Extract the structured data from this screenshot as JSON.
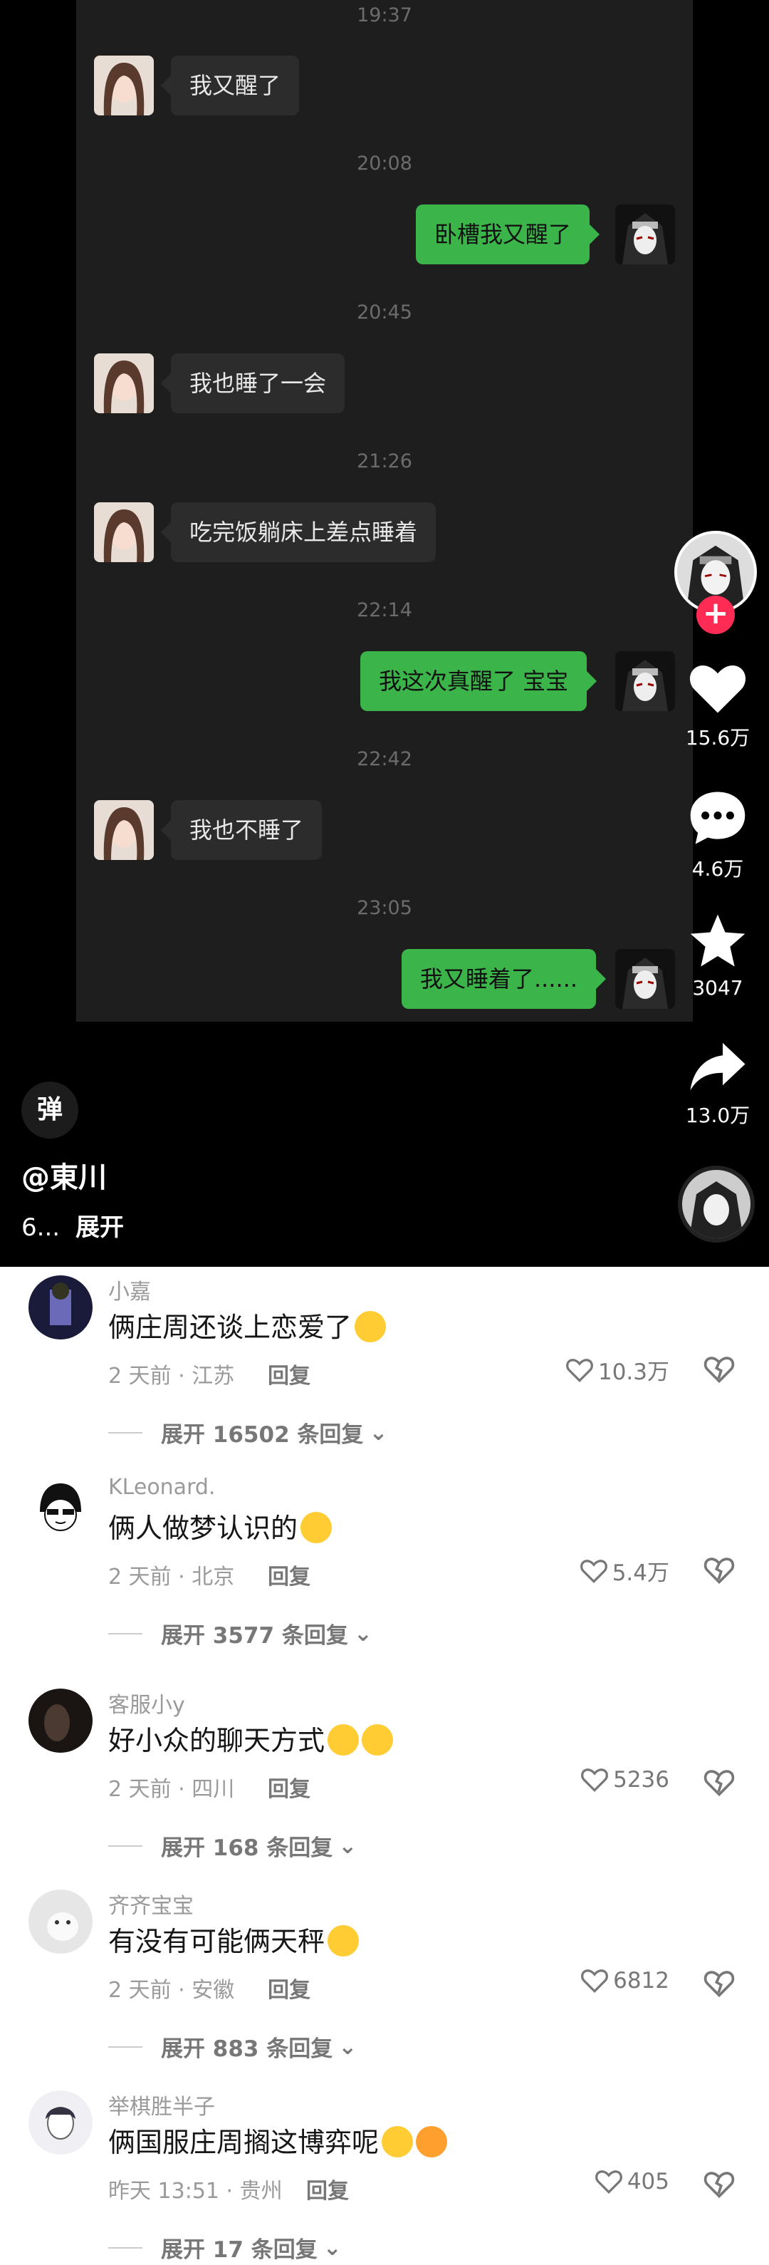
{
  "chat": {
    "timestamps": [
      "19:37",
      "20:08",
      "20:45",
      "21:26",
      "22:14",
      "22:42",
      "23:05"
    ],
    "messages": [
      {
        "side": "in",
        "text": "我又醒了"
      },
      {
        "side": "out",
        "text": "卧槽我又醒了"
      },
      {
        "side": "in",
        "text": "我也睡了一会"
      },
      {
        "side": "in",
        "text": "吃完饭躺床上差点睡着"
      },
      {
        "side": "out",
        "text": "我这次真醒了 宝宝"
      },
      {
        "side": "in",
        "text": "我也不睡了"
      },
      {
        "side": "out",
        "text": "我又睡着了......"
      }
    ]
  },
  "rail": {
    "likes": "15.6万",
    "comments": "4.6万",
    "favorites": "3047",
    "shares": "13.0万",
    "follow_icon": "plus-icon"
  },
  "video_info": {
    "danmu_label": "弹",
    "author": "@東川",
    "desc": "6...",
    "expand": "展开"
  },
  "comments": [
    {
      "name": "小嘉",
      "text": "俩庄周还谈上恋爱了",
      "emoji": "rofl-emoji",
      "time": "2 天前 · 江苏",
      "reply": "回复",
      "likes": "10.3万",
      "expand": "展开 16502 条回复"
    },
    {
      "name": "KLeonard.",
      "text": "俩人做梦认识的",
      "emoji": "thinking-emoji",
      "time": "2 天前 · 北京",
      "reply": "回复",
      "likes": "5.4万",
      "expand": "展开 3577 条回复"
    },
    {
      "name": "客服小y",
      "text": "好小众的聊天方式",
      "emoji": "smile-ok-emoji",
      "time": "2 天前 · 四川",
      "reply": "回复",
      "likes": "5236",
      "expand": "展开 168 条回复"
    },
    {
      "name": "齐齐宝宝",
      "text": "有没有可能俩天秤",
      "emoji": "party-emoji",
      "time": "2 天前 · 安徽",
      "reply": "回复",
      "likes": "6812",
      "expand": "展开 883 条回复"
    },
    {
      "name": "举棋胜半子",
      "text": "俩国服庄周搁这博弈呢",
      "emoji": "rofl-clap-emoji",
      "time": "昨天 13:51 · 贵州",
      "reply": "回复",
      "likes": "405",
      "expand": "展开 17 条回复"
    }
  ],
  "colors": {
    "bubble_out": "#3bb54a",
    "bubble_in": "#2c2c2c",
    "follow": "#fe2c55"
  }
}
